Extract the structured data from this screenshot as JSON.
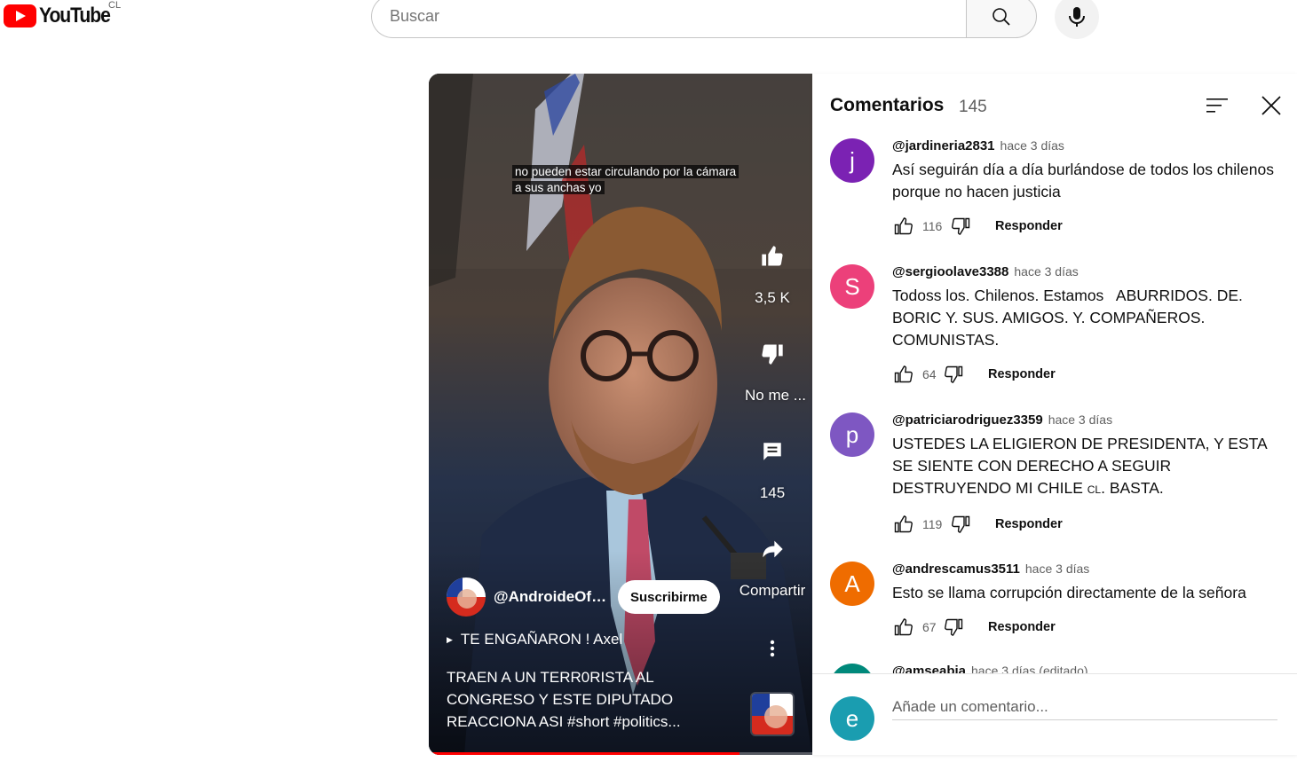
{
  "header": {
    "logo_text": "YouTube",
    "country": "CL",
    "search_placeholder": "Buscar"
  },
  "video": {
    "caption_line1": "no pueden estar circulando por la cámara",
    "caption_line2": "a sus anchas yo",
    "likes": "3,5 K",
    "dislike_label": "No me ...",
    "comments_count": "145",
    "share_label": "Compartir",
    "channel_name": "@AndroideOfficial",
    "subscribe_label": "Suscribirme",
    "playlist": "TE ENGAÑARON ! Axel",
    "title": "TRAEN A UN TERR0RISTA AL CONGRESO Y ESTE DIPUTADO REACCIONA ASI #short #politics...",
    "progress": 0.81
  },
  "comments_panel": {
    "title": "Comentarios",
    "count": "145",
    "add_placeholder": "Añade un comentario...",
    "current_user_initial": "e",
    "reply_label": "Responder",
    "comments": [
      {
        "initial": "j",
        "color": "#7b22b3",
        "author": "@jardineria2831",
        "time": "hace 3 días",
        "text": "Así seguirán día a día burlándose de todos los chilenos porque no  hacen justicia",
        "likes": "116"
      },
      {
        "initial": "S",
        "color": "#ec407a",
        "author": "@sergioolave3388",
        "time": "hace 3 días",
        "text": "Todoss los. Chilenos. Estamos   ABURRIDOS. DE. BORIC Y. SUS. AMIGOS. Y. COMPAÑEROS. COMUNISTAS.",
        "likes": "64"
      },
      {
        "initial": "p",
        "color": "#7e57c2",
        "author": "@patriciarodriguez3359",
        "time": "hace 3 días",
        "text_before": "USTEDES LA ELIGIERON DE PRESIDENTA, Y ESTA SE SIENTE CON DERECHO A SEGUIR DESTRUYENDO MI CHILE ",
        "text_flag": "CL",
        "text_after": ". BASTA.",
        "likes": "119"
      },
      {
        "initial": "A",
        "color": "#ef6c00",
        "author": "@andrescamus3511",
        "time": "hace 3 días",
        "text": "Esto se llama corrupción directamente de la señora",
        "likes": "67"
      },
      {
        "initial": "",
        "color": "#00897b",
        "author": "@amseabia",
        "time": "hace 3 días (editado)",
        "text": "",
        "likes": ""
      }
    ]
  }
}
